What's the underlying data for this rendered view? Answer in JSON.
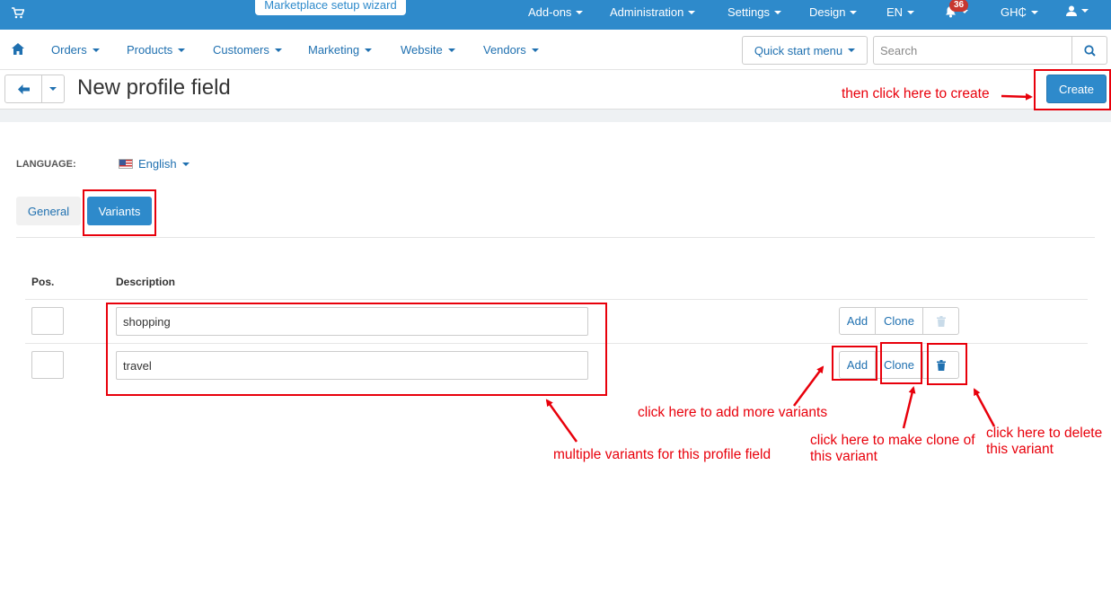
{
  "topbar": {
    "wizard": "Marketplace setup wizard",
    "menu": [
      "Add-ons",
      "Administration",
      "Settings",
      "Design",
      "EN",
      "GH₵"
    ],
    "notifications_count": "36"
  },
  "navbar": {
    "items": [
      "Orders",
      "Products",
      "Customers",
      "Marketing",
      "Website",
      "Vendors"
    ],
    "quick_start": "Quick start menu",
    "search_placeholder": "Search"
  },
  "titlebar": {
    "title": "New profile field",
    "create_label": "Create"
  },
  "content": {
    "language_label": "LANGUAGE:",
    "language_value": "English",
    "tabs": [
      "General",
      "Variants"
    ],
    "columns": [
      "Pos.",
      "Description"
    ],
    "rows": [
      {
        "pos": "",
        "description": "shopping",
        "add": "Add",
        "clone": "Clone"
      },
      {
        "pos": "",
        "description": "travel",
        "add": "Add",
        "clone": "Clone"
      }
    ]
  },
  "annotations": {
    "create": "then click here to create",
    "add": "click here to add more variants",
    "clone": "click here to make clone of this variant",
    "delete": "click here to delete this variant",
    "variants": "multiple variants for this profile field"
  },
  "colors": {
    "primary": "#2e8acb",
    "link": "#1f70b0",
    "annotation": "#e8000b"
  }
}
